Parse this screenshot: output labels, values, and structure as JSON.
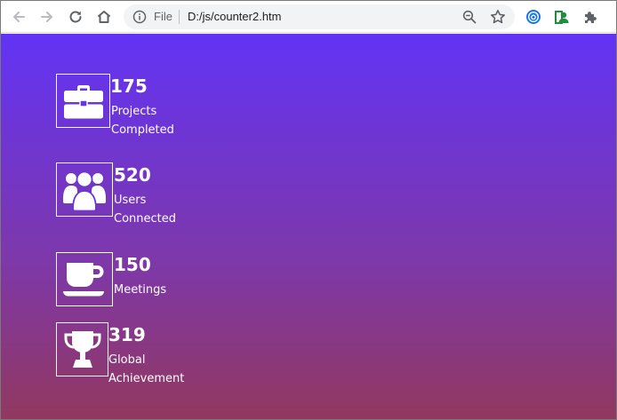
{
  "browser": {
    "omnibox": {
      "scheme_label": "File",
      "url": "D:/js/counter2.htm"
    }
  },
  "counters": [
    {
      "count": "175",
      "label_line1": "Projects",
      "label_line2": "Completed",
      "icon": "briefcase-icon"
    },
    {
      "count": "520",
      "label_line1": "Users",
      "label_line2": "Connected",
      "icon": "users-icon"
    },
    {
      "count": "150",
      "label_line1": "Meetings",
      "label_line2": "",
      "icon": "coffee-cup-icon"
    },
    {
      "count": "319",
      "label_line1": "Global",
      "label_line2": "Achievement",
      "icon": "trophy-icon"
    }
  ],
  "colors": {
    "gradient_top": "#6233f5",
    "gradient_middle": "#7e38a8",
    "gradient_bottom": "#92385f",
    "text": "#ffffff"
  }
}
